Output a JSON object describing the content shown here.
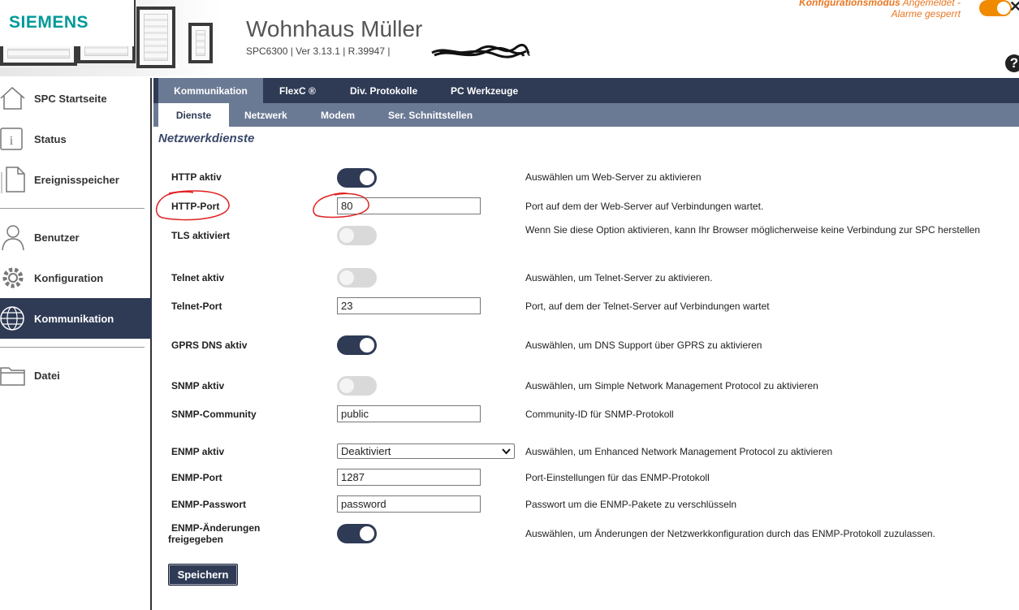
{
  "header": {
    "brand": "SIEMENS",
    "title": "Wohnhaus Müller",
    "subtitle": "SPC6300  |  Ver 3.13.1  |  R.39947  |",
    "mode_line1_bold": "Konfigurationsmodus",
    "mode_line1_rest": " Angemeldet -",
    "mode_line2": "Alarme gesperrt",
    "help_glyph": "?",
    "close_glyph": "✕"
  },
  "colors": {
    "navy": "#2f3b55",
    "subnav": "#6b7a94",
    "accent": "#e87722",
    "brand": "#009999"
  },
  "sidebar": {
    "items": [
      {
        "label": "SPC Startseite",
        "icon": "home-icon"
      },
      {
        "label": "Status",
        "icon": "info-icon"
      },
      {
        "label": "Ereignisspeicher",
        "icon": "document-icon"
      },
      {
        "label": "Benutzer",
        "icon": "user-icon"
      },
      {
        "label": "Konfiguration",
        "icon": "gear-icon"
      },
      {
        "label": "Kommunikation",
        "icon": "globe-icon",
        "active": true
      },
      {
        "label": "Datei",
        "icon": "folder-icon"
      }
    ]
  },
  "tabs": {
    "primary": [
      "Kommunikation",
      "FlexC ®",
      "Div. Protokolle",
      "PC Werkzeuge"
    ],
    "secondary": [
      "Dienste",
      "Netzwerk",
      "Modem",
      "Ser. Schnittstellen"
    ]
  },
  "section_title": "Netzwerkdienste",
  "form": {
    "http_active": {
      "label": "HTTP aktiv",
      "on": true,
      "help": "Auswählen um Web-Server zu aktivieren"
    },
    "http_port": {
      "label": "HTTP-Port",
      "value": "80",
      "help": "Port auf dem der Web-Server auf Verbindungen wartet."
    },
    "tls": {
      "label": "TLS aktiviert",
      "on": false,
      "help": "Wenn Sie diese Option aktivieren, kann Ihr Browser möglicherweise keine Verbindung zur SPC herstellen"
    },
    "telnet_active": {
      "label": "Telnet aktiv",
      "on": false,
      "help": "Auswählen, um Telnet-Server zu aktivieren."
    },
    "telnet_port": {
      "label": "Telnet-Port",
      "value": "23",
      "help": "Port, auf dem der Telnet-Server auf Verbindungen wartet"
    },
    "gprs_dns": {
      "label": "GPRS DNS aktiv",
      "on": true,
      "help": "Auswählen, um DNS Support über GPRS zu aktivieren"
    },
    "snmp_active": {
      "label": "SNMP aktiv",
      "on": false,
      "help": "Auswählen, um Simple Network Management Protocol zu aktivieren"
    },
    "snmp_community": {
      "label": "SNMP-Community",
      "value": "public",
      "help": "Community-ID für SNMP-Protokoll"
    },
    "enmp_active": {
      "label": "ENMP aktiv",
      "value": "Deaktiviert",
      "help": "Auswählen, um Enhanced Network Management Protocol zu aktivieren"
    },
    "enmp_port": {
      "label": "ENMP-Port",
      "value": "1287",
      "help": "Port-Einstellungen für das ENMP-Protokoll"
    },
    "enmp_password": {
      "label": "ENMP-Passwort",
      "value": "password",
      "help": "Passwort um die ENMP-Pakete zu verschlüsseln"
    },
    "enmp_changes": {
      "label_line1": "ENMP-Änderungen",
      "label_line2": "freigegeben",
      "on": true,
      "help": "Auswählen, um Änderungen der Netzwerkkonfiguration durch das ENMP-Protokoll zuzulassen."
    }
  },
  "save_label": "Speichern"
}
